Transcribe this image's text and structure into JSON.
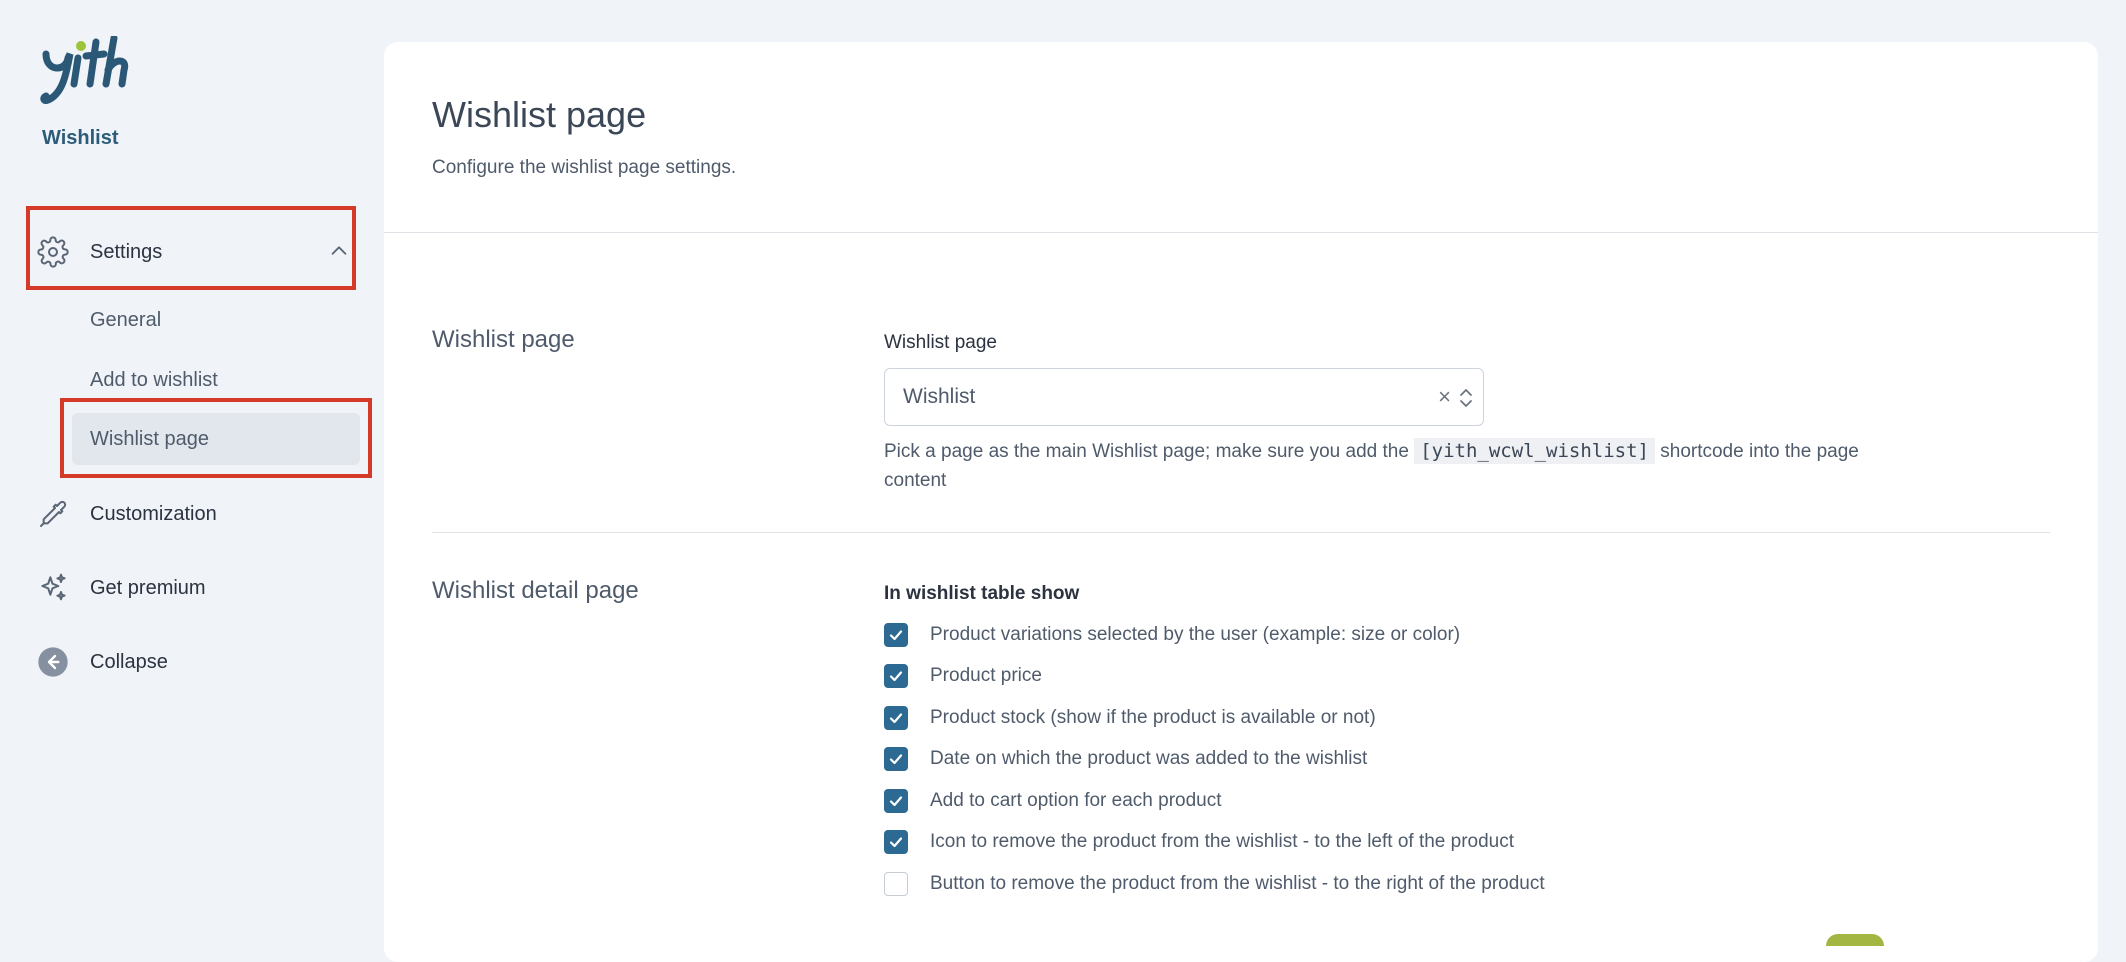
{
  "sidebar": {
    "brand": "Wishlist",
    "nav": {
      "settings": "Settings",
      "customization": "Customization",
      "premium": "Get premium",
      "collapse": "Collapse"
    },
    "sub_items": [
      {
        "label": "General",
        "active": false
      },
      {
        "label": "Add to wishlist",
        "active": false
      },
      {
        "label": "Wishlist page",
        "active": true
      }
    ]
  },
  "header": {
    "title": "Wishlist page",
    "subtitle": "Configure the wishlist page settings."
  },
  "sections": {
    "wishlist_page": {
      "title": "Wishlist page",
      "field_label": "Wishlist page",
      "select_value": "Wishlist",
      "clear_glyph": "×",
      "help_before": "Pick a page as the main Wishlist page; make sure you add the",
      "help_code": "[yith_wcwl_wishlist]",
      "help_after": "shortcode into the page content"
    },
    "detail_page": {
      "title": "Wishlist detail page",
      "field_label": "In wishlist table show",
      "options": [
        {
          "label": "Product variations selected by the user (example: size or color)",
          "checked": true
        },
        {
          "label": "Product price",
          "checked": true
        },
        {
          "label": "Product stock (show if the product is available or not)",
          "checked": true
        },
        {
          "label": "Date on which the product was added to the wishlist",
          "checked": true
        },
        {
          "label": "Add to cart option for each product",
          "checked": true
        },
        {
          "label": "Icon to remove the product from the wishlist - to the left of the product",
          "checked": true
        },
        {
          "label": "Button to remove the product from the wishlist - to the right of the product",
          "checked": false
        }
      ]
    }
  },
  "colors": {
    "accent": "#2c6a93",
    "brand_text": "#2c5c79",
    "highlight": "#d53a28",
    "toggle_on": "#a3b641",
    "logo_leaf": "#9cc43b"
  }
}
